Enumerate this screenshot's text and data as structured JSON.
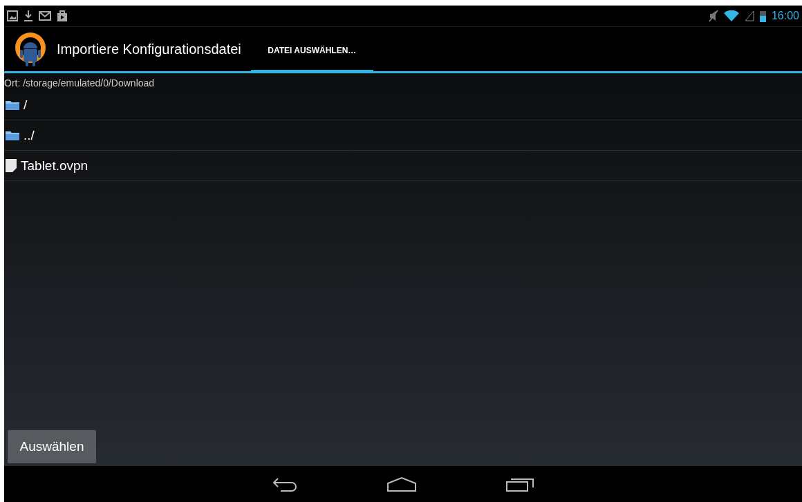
{
  "status_bar": {
    "time": "16:00"
  },
  "action_bar": {
    "title": "Importiere Konfigurationsdatei",
    "tabs": [
      {
        "label": "DATEI AUSWÄHLEN…",
        "selected": true
      }
    ]
  },
  "location": "Ort: /storage/emulated/0/Download",
  "files": [
    {
      "name": "/",
      "kind": "folder"
    },
    {
      "name": "../",
      "kind": "folder"
    },
    {
      "name": "Tablet.ovpn",
      "kind": "file"
    }
  ],
  "button": "Auswählen"
}
